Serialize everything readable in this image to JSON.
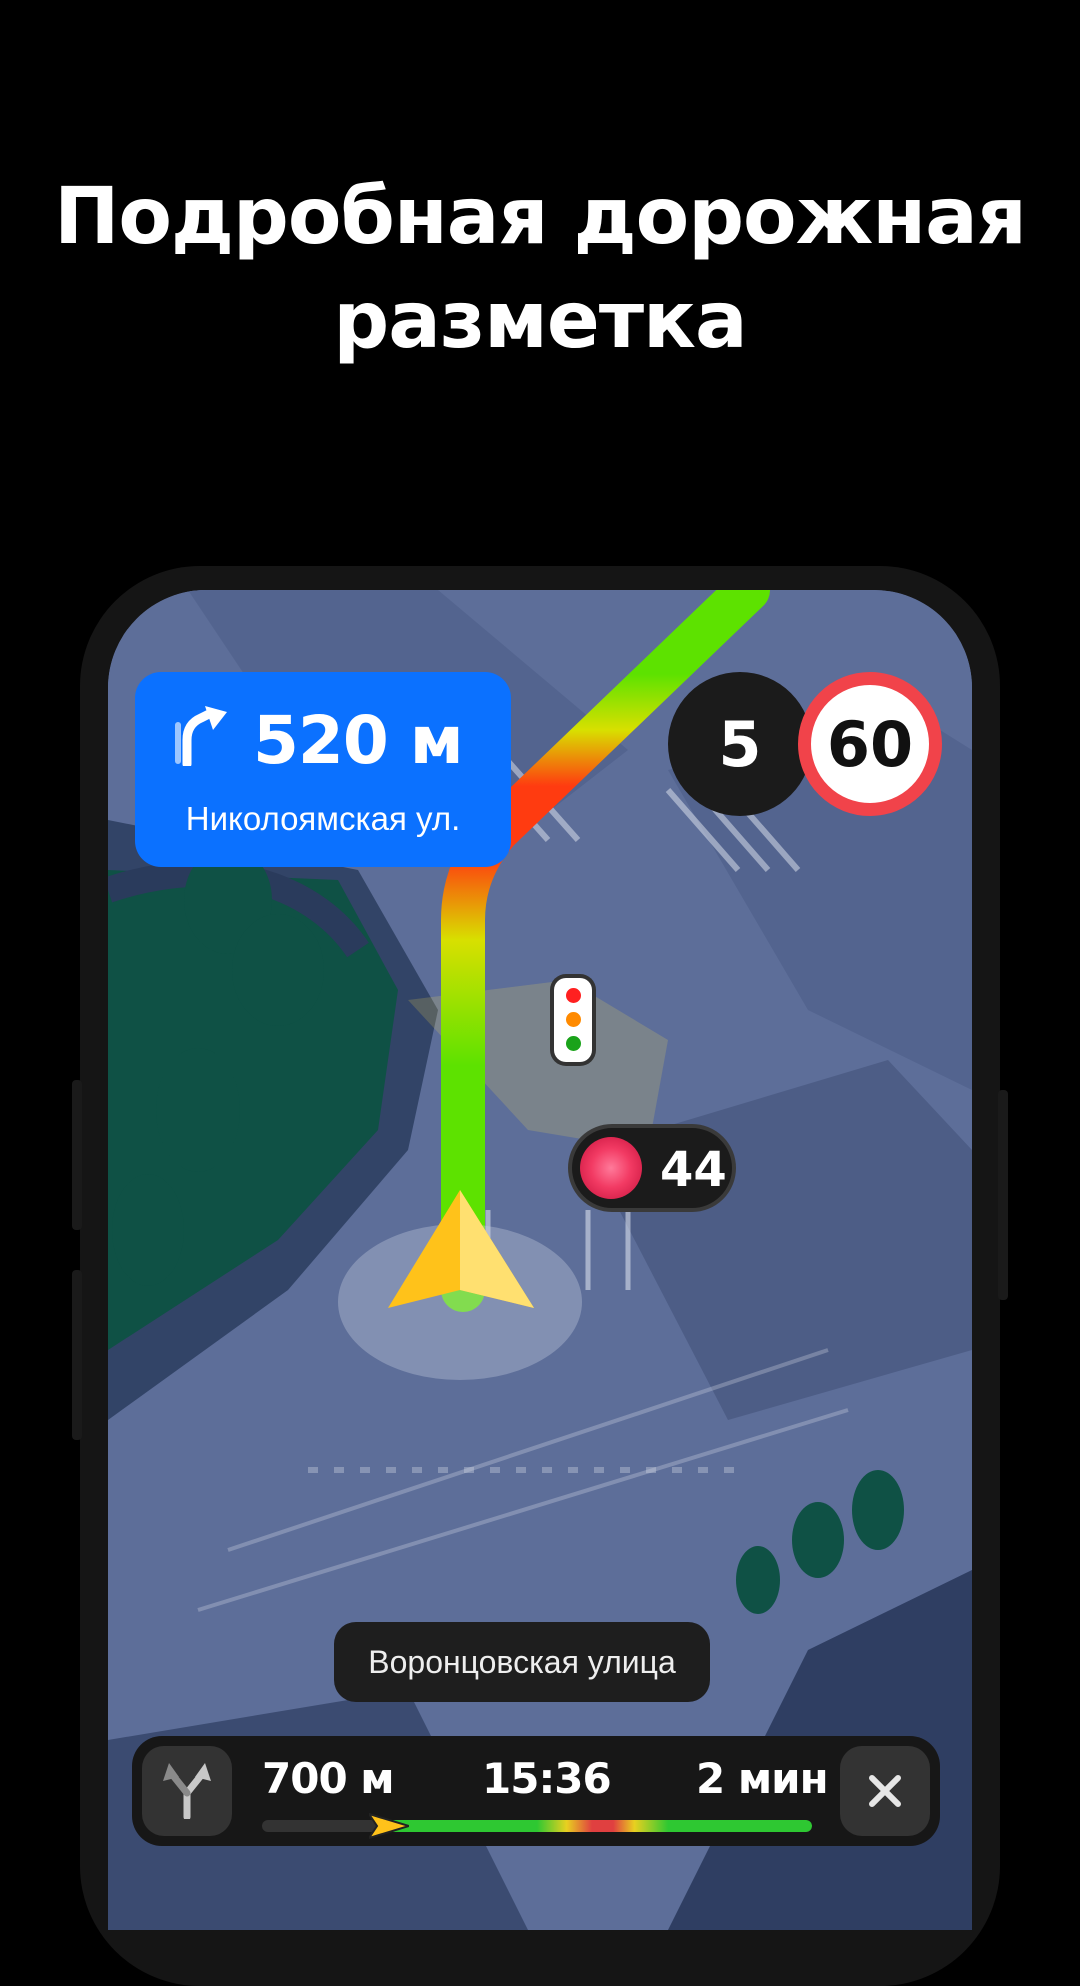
{
  "headline": {
    "line1": "Подробная дорожная",
    "line2": "разметка"
  },
  "maneuver": {
    "icon": "turn-right-icon",
    "distance": "520 м",
    "street": "Николоямская ул."
  },
  "speed": {
    "current": "5",
    "limit": "60"
  },
  "traffic_light": {
    "icon": "traffic-light-icon",
    "countdown": "44"
  },
  "street_toast": "Воронцовская улица",
  "bottom_bar": {
    "route_icon": "route-fork-icon",
    "distance": "700 м",
    "arrival_time": "15:36",
    "remaining_time": "2 мин",
    "close_icon": "close-icon",
    "progress": 0.23
  },
  "colors": {
    "accent": "#0b71ff",
    "route_green": "#5de200",
    "route_red": "#ff3b10",
    "limit_ring": "#f1434a",
    "map_road": "#5d6e99",
    "park": "#0f5145"
  }
}
